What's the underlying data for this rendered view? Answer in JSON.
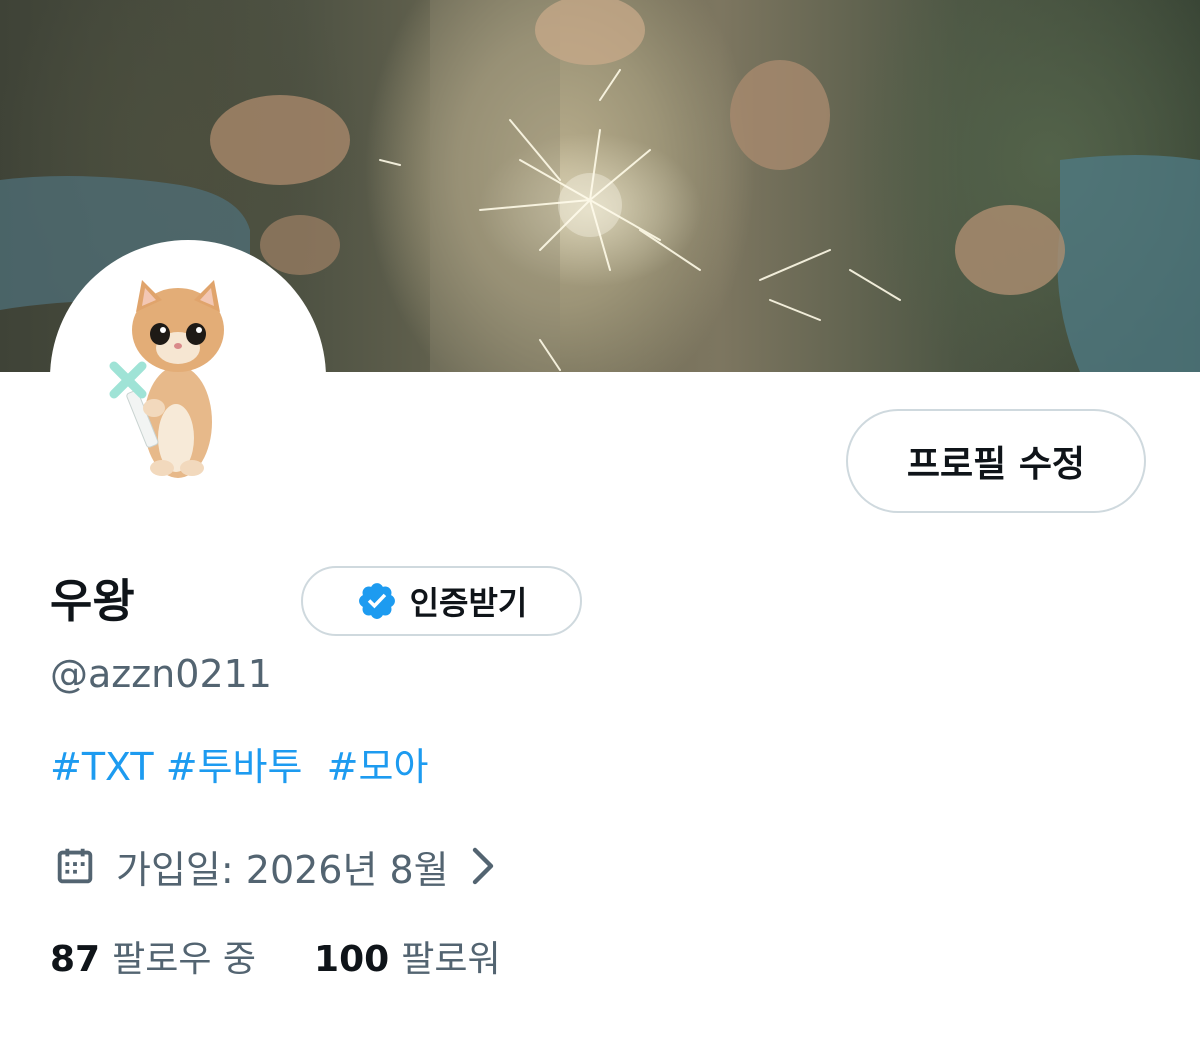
{
  "profile": {
    "display_name": "우왕",
    "handle": "@azzn0211",
    "bio_tags": [
      "#TXT",
      "#투바투",
      "#모아"
    ],
    "joined": "가입일: 2026년 8월"
  },
  "buttons": {
    "edit_profile": "프로필 수정",
    "get_verified": "인증받기"
  },
  "stats": {
    "following_count": "87",
    "following_label": "팔로우 중",
    "followers_count": "100",
    "followers_label": "팔로워"
  },
  "colors": {
    "link": "#1d9bf0",
    "text_primary": "#0f1419",
    "text_secondary": "#536471",
    "button_border": "#cfd9de",
    "verified_badge": "#1d9bf0"
  },
  "icons": {
    "verified": "verified-badge-icon",
    "calendar": "calendar-icon",
    "chevron": "chevron-right-icon"
  }
}
